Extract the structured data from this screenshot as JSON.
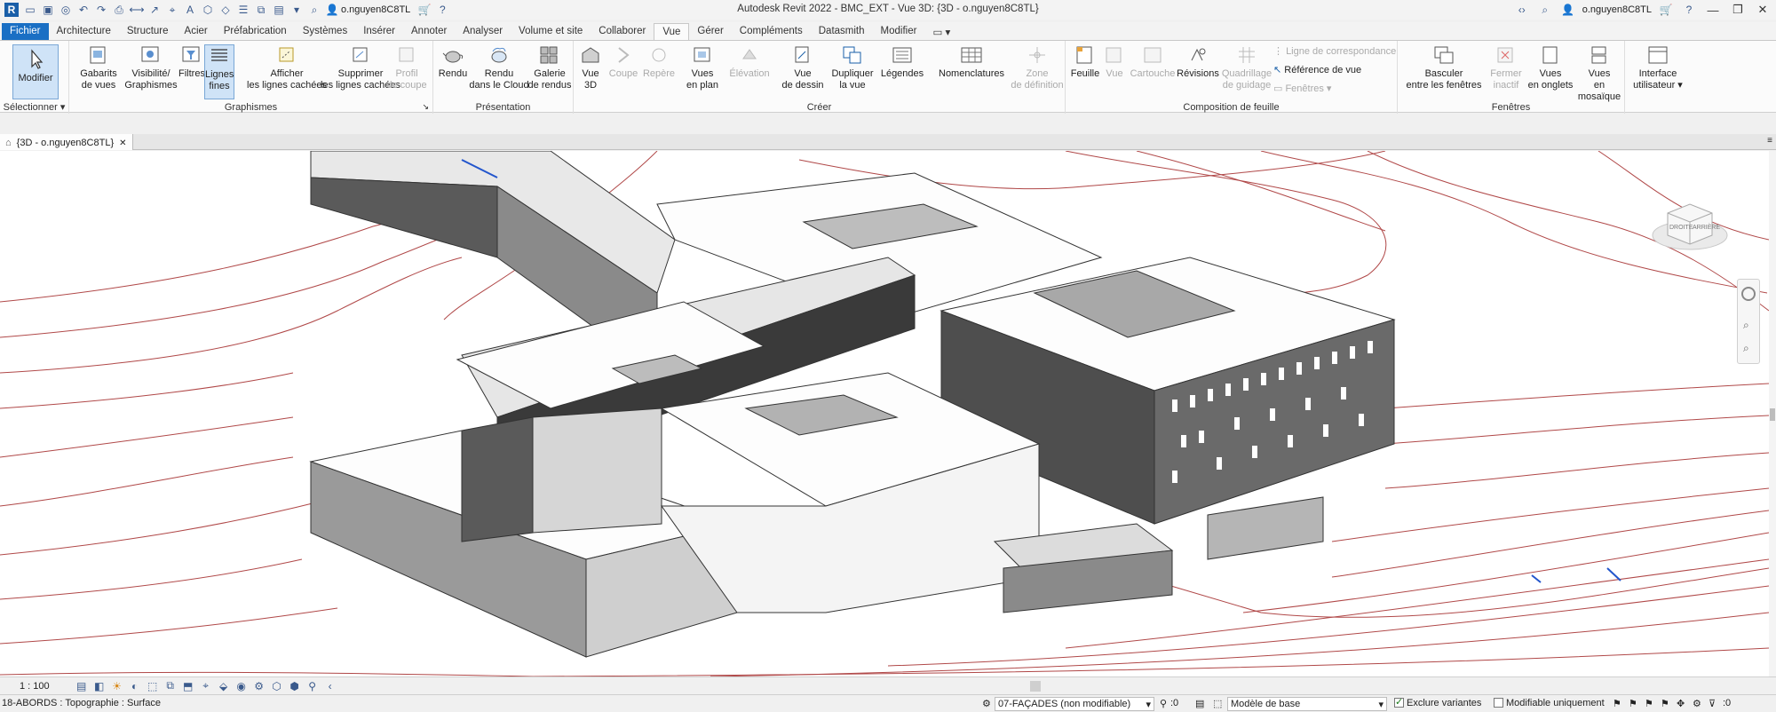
{
  "titlebar": {
    "title": "Autodesk Revit 2022 - BMC_EXT - Vue 3D: {3D - o.nguyen8C8TL}",
    "user": "o.nguyen8C8TL",
    "user_right": "o.nguyen8C8TL",
    "help": "?"
  },
  "tabs": [
    "Fichier",
    "Architecture",
    "Structure",
    "Acier",
    "Préfabrication",
    "Systèmes",
    "Insérer",
    "Annoter",
    "Analyser",
    "Volume et site",
    "Collaborer",
    "Vue",
    "Gérer",
    "Compléments",
    "Datasmith",
    "Modifier"
  ],
  "ribbon": {
    "select": {
      "label": "Modifier",
      "panel": "Sélectionner"
    },
    "graphismes": {
      "panel": "Graphismes",
      "buttons": [
        {
          "l1": "Gabarits",
          "l2": "de vues"
        },
        {
          "l1": "Visibilité/",
          "l2": "Graphismes"
        },
        {
          "l1": "Filtres",
          "l2": ""
        },
        {
          "l1": "Lignes",
          "l2": "fines"
        },
        {
          "l1": "Afficher",
          "l2": "les lignes cachées"
        },
        {
          "l1": "Supprimer",
          "l2": "les lignes cachées"
        },
        {
          "l1": "Profil",
          "l2": "de coupe"
        }
      ]
    },
    "presentation": {
      "panel": "Présentation",
      "buttons": [
        {
          "l1": "Rendu",
          "l2": ""
        },
        {
          "l1": "Rendu",
          "l2": "dans le Cloud"
        },
        {
          "l1": "Galerie",
          "l2": "de rendus"
        }
      ]
    },
    "creer": {
      "panel": "Créer",
      "buttons": [
        {
          "l1": "Vue",
          "l2": "3D"
        },
        {
          "l1": "Coupe",
          "l2": ""
        },
        {
          "l1": "Repère",
          "l2": ""
        },
        {
          "l1": "Vues",
          "l2": "en plan"
        },
        {
          "l1": "Élévation",
          "l2": ""
        },
        {
          "l1": "Vue",
          "l2": "de dessin"
        },
        {
          "l1": "Dupliquer",
          "l2": "la vue"
        },
        {
          "l1": "Légendes",
          "l2": ""
        },
        {
          "l1": "Nomenclatures",
          "l2": ""
        },
        {
          "l1": "Zone",
          "l2": "de définition"
        }
      ]
    },
    "composition": {
      "panel": "Composition de feuille",
      "buttons": [
        {
          "l1": "Feuille",
          "l2": ""
        },
        {
          "l1": "Vue",
          "l2": ""
        },
        {
          "l1": "Cartouche",
          "l2": ""
        },
        {
          "l1": "Révisions",
          "l2": ""
        },
        {
          "l1": "Quadrillage",
          "l2": "de guidage"
        }
      ],
      "small": [
        "Ligne de correspondance",
        "Référence de vue",
        "Fenêtres"
      ]
    },
    "fenetres": {
      "panel": "Fenêtres",
      "buttons": [
        {
          "l1": "Basculer",
          "l2": "entre les fenêtres"
        },
        {
          "l1": "Fermer",
          "l2": "inactif"
        },
        {
          "l1": "Vues",
          "l2": "en onglets"
        },
        {
          "l1": "Vues",
          "l2": "en mosaïque"
        }
      ]
    },
    "interface": {
      "l1": "Interface",
      "l2": "utilisateur"
    }
  },
  "doc_tab": {
    "label": "{3D - o.nguyen8C8TL}"
  },
  "viewcube": {
    "face1": "DROITE",
    "face2": "ARRIÈRE"
  },
  "viewctrl": {
    "scale": "1 : 100"
  },
  "statusbar": {
    "left": "18-ABORDS : Topographie : Surface",
    "workset": "07-FAÇADES (non modifiable)",
    "worksets_count": ":0",
    "design_option": "Modèle de base",
    "exclude_variants": "Exclure variantes",
    "editable_only": "Modifiable uniquement",
    "filter_count": ":0"
  },
  "colors": {
    "accent": "#1a6fc4",
    "topo_line": "#b04040",
    "selection": "#2255cc"
  }
}
